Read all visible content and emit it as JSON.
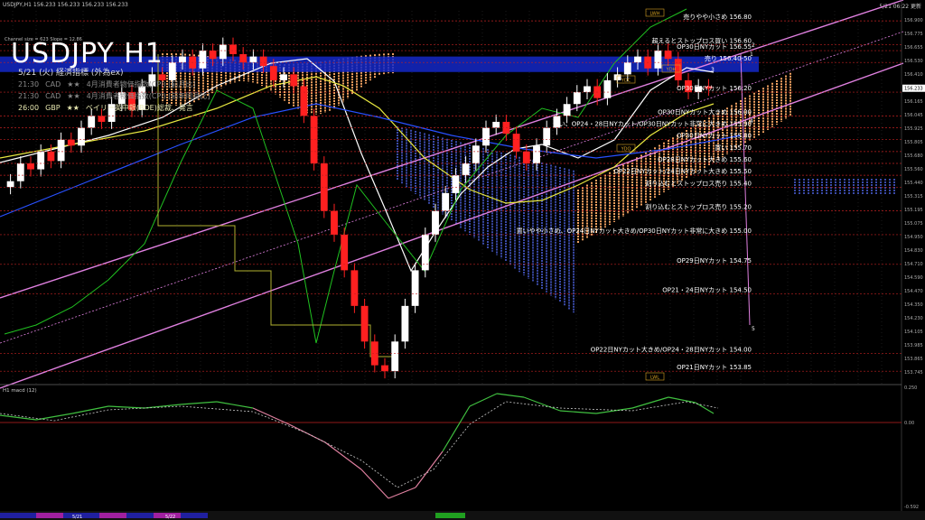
{
  "header": {
    "left": "USDJPY,H1  156.233 156.233 156.233 156.233",
    "right": "5/21 06:22 更新"
  },
  "chart_title": "USDJPY H1",
  "indicator_info": "Channel size = 623 Slope = 12.86",
  "econ": {
    "title": "5/21 (火) 経済指標 (外為ex)",
    "events": [
      {
        "time": "21:30",
        "country": "CAD",
        "stars": "★★",
        "name": "4月消費者物価指数(CPI) [前月比]",
        "hl": false
      },
      {
        "time": "21:30",
        "country": "CAD",
        "stars": "★★",
        "name": "4月消費者物価指数(CPI) [前年同月比]",
        "hl": false
      },
      {
        "time": "26:00",
        "country": "GBP",
        "stars": "★★",
        "name": "ベイリー英中銀(BOE)総裁、発言",
        "hl": true
      }
    ]
  },
  "price_axis": {
    "labels": [
      "156.900",
      "156.775",
      "156.655",
      "156.530",
      "156.410",
      "156.290",
      "156.165",
      "156.045",
      "155.925",
      "155.805",
      "155.680",
      "155.560",
      "155.440",
      "155.315",
      "155.195",
      "155.075",
      "154.950",
      "154.830",
      "154.710",
      "154.590",
      "154.470",
      "154.350",
      "154.230",
      "154.105",
      "153.985",
      "153.865",
      "153.745"
    ],
    "current": "156.233"
  },
  "macd": {
    "label": "H1  macd (12)",
    "top": "0.250",
    "zero": "0.00",
    "bottom": "-0.592"
  },
  "time_axis": {
    "labels": [
      "5/21",
      "5/22"
    ]
  },
  "colors": {
    "sell_band": "#1428c8",
    "channel": "#e080e0",
    "white_ma": "#ffffff",
    "yellow_ma": "#e8e840",
    "blue_ma": "#2850ff",
    "green": "#20c020",
    "up": "#ffffff",
    "down": "#ff2020"
  },
  "chart_data": {
    "type": "candlestick",
    "price_levels": [
      {
        "label": "売りやや小さめ 156.80",
        "price": 156.8,
        "color": "#ffffff"
      },
      {
        "label": "超えるとストップロス買い 156.60",
        "price": 156.6,
        "color": "#ffffff"
      },
      {
        "label": "OP30日NYカット 156.55",
        "price": 156.55,
        "color": "#ffffff"
      },
      {
        "label": "売り 156.40-50",
        "price": 156.45,
        "color": "#ffffff",
        "band": true
      },
      {
        "label": "OP30日NYカット 156.20",
        "price": 156.2,
        "color": "#ffffff"
      },
      {
        "label": "OP30日NYカット大きめ 156.00",
        "price": 156.0,
        "color": "#ffffff"
      },
      {
        "label": "買い、OP24・28日NYカット/OP30日NYカット非常に大きめ 155.90",
        "price": 155.9,
        "color": "#ffffff"
      },
      {
        "label": "OP30日NYカット 155.80",
        "price": 155.8,
        "color": "#ffffff"
      },
      {
        "label": "買い 155.70",
        "price": 155.7,
        "color": "#ffffff"
      },
      {
        "label": "OP28日NYカット大きめ 155.60",
        "price": 155.6,
        "color": "#ffffff"
      },
      {
        "label": "OP22日NYカット/24日NYカット大きめ 155.50",
        "price": 155.5,
        "color": "#ffffff"
      },
      {
        "label": "割り込むとストップロス売り 155.40",
        "price": 155.4,
        "color": "#ffffff"
      },
      {
        "label": "割り込むとストップロス売り 155.20",
        "price": 155.2,
        "color": "#ffffff"
      },
      {
        "label": "買いやや小さめ、OP24日NYカット大きめ/OP30日NYカット非常に大きめ 155.00",
        "price": 155.0,
        "color": "#ffffff"
      },
      {
        "label": "OP29日NYカット 154.75",
        "price": 154.75,
        "color": "#ffffff"
      },
      {
        "label": "OP21・24日NYカット 154.50",
        "price": 154.5,
        "color": "#ffffff"
      },
      {
        "label": "OP22日NYカット大きめ/OP24・28日NYカット 154.00",
        "price": 154.0,
        "color": "#ffffff"
      },
      {
        "label": "OP21日NYカット 153.85",
        "price": 153.85,
        "color": "#ffffff"
      }
    ],
    "tags": [
      "LWH",
      "YDH",
      "YDC",
      "YDO",
      "LWL"
    ],
    "markers": [
      "2",
      "1",
      "3",
      "4",
      "5"
    ]
  }
}
